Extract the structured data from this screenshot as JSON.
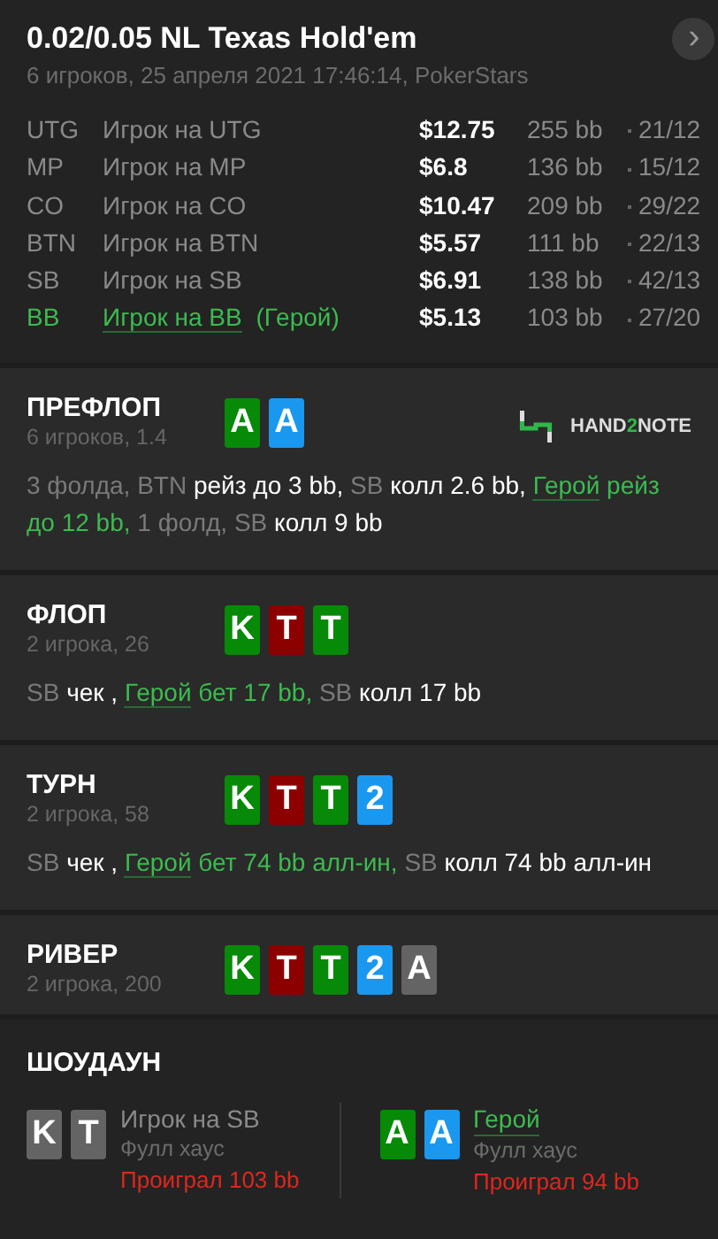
{
  "header": {
    "title": "0.02/0.05 NL Texas Hold'em",
    "subtitle": "6 игроков, 25 апреля 2021 17:46:14, PokerStars",
    "next_button": "›"
  },
  "players": [
    {
      "position": "UTG",
      "name": "Игрок на UTG",
      "hero": false,
      "stack": "$12.75",
      "bb": "255 bb",
      "stats": "21/12"
    },
    {
      "position": "MP",
      "name": "Игрок на MP",
      "hero": false,
      "stack": "$6.8",
      "bb": "136 bb",
      "stats": "15/12"
    },
    {
      "position": "CO",
      "name": "Игрок на CO",
      "hero": false,
      "stack": "$10.47",
      "bb": "209 bb",
      "stats": "29/22"
    },
    {
      "position": "BTN",
      "name": "Игрок на BTN",
      "hero": false,
      "stack": "$5.57",
      "bb": "111 bb",
      "stats": "22/13"
    },
    {
      "position": "SB",
      "name": "Игрок на SB",
      "hero": false,
      "stack": "$6.91",
      "bb": "138 bb",
      "stats": "42/13"
    },
    {
      "position": "BB",
      "name": "Игрок на BB",
      "hero": true,
      "hero_tag": "(Герой)",
      "stack": "$5.13",
      "bb": "103 bb",
      "stats": "27/20"
    }
  ],
  "streets": [
    {
      "name": "ПРЕФЛОП",
      "info": "6 игроков, 1.4",
      "logo": [
        "HAND",
        "2",
        "NOTE"
      ],
      "cards": [
        {
          "rank": "A",
          "color": "#078a07"
        },
        {
          "rank": "A",
          "color": "#1a98f0"
        }
      ],
      "actions": [
        {
          "kind": "player",
          "text": "3 фолда, BTN "
        },
        {
          "kind": "action",
          "text": "рейз до 3 bb, "
        },
        {
          "kind": "player",
          "text": "SB "
        },
        {
          "kind": "action",
          "text": "колл 2.6 bb, "
        },
        {
          "kind": "hero",
          "text": "Герой"
        },
        {
          "kind": "hero_action",
          "text": " рейз до 12 bb, "
        },
        {
          "kind": "player",
          "text": "1 фолд, SB "
        },
        {
          "kind": "action",
          "text": "колл 9 bb"
        }
      ]
    },
    {
      "name": "ФЛОП",
      "info": "2 игрока, 26",
      "cards": [
        {
          "rank": "K",
          "color": "#078a07"
        },
        {
          "rank": "T",
          "color": "#8c0000"
        },
        {
          "rank": "T",
          "color": "#078a07"
        }
      ],
      "actions": [
        {
          "kind": "player",
          "text": "SB "
        },
        {
          "kind": "action",
          "text": "чек , "
        },
        {
          "kind": "hero",
          "text": "Герой"
        },
        {
          "kind": "hero_action",
          "text": " бет 17 bb, "
        },
        {
          "kind": "player",
          "text": "SB "
        },
        {
          "kind": "action",
          "text": "колл 17 bb"
        }
      ]
    },
    {
      "name": "ТУРН",
      "info": "2 игрока, 58",
      "cards": [
        {
          "rank": "K",
          "color": "#078a07"
        },
        {
          "rank": "T",
          "color": "#8c0000"
        },
        {
          "rank": "T",
          "color": "#078a07"
        },
        {
          "rank": "2",
          "color": "#1a98f0"
        }
      ],
      "actions": [
        {
          "kind": "player",
          "text": "SB "
        },
        {
          "kind": "action",
          "text": "чек , "
        },
        {
          "kind": "hero",
          "text": "Герой"
        },
        {
          "kind": "hero_action",
          "text": " бет 74 bb алл-ин, "
        },
        {
          "kind": "player",
          "text": "SB "
        },
        {
          "kind": "action",
          "text": "колл 74 bb алл-ин"
        }
      ]
    },
    {
      "name": "РИВЕР",
      "info": "2 игрока, 200",
      "cards": [
        {
          "rank": "K",
          "color": "#078a07"
        },
        {
          "rank": "T",
          "color": "#8c0000"
        },
        {
          "rank": "T",
          "color": "#078a07"
        },
        {
          "rank": "2",
          "color": "#1a98f0"
        },
        {
          "rank": "A",
          "color": "#646464"
        }
      ]
    }
  ],
  "showdown": {
    "title": "ШОУДАУН",
    "players": [
      {
        "name": "Игрок на SB",
        "hero": false,
        "hand": "Фулл хаус",
        "result": "Проиграл 103 bb",
        "cards": [
          {
            "rank": "K",
            "color": "#646464"
          },
          {
            "rank": "T",
            "color": "#646464"
          }
        ]
      },
      {
        "name": "Герой",
        "hero": true,
        "hand": "Фулл хаус",
        "result": "Проиграл 94 bb",
        "cards": [
          {
            "rank": "A",
            "color": "#078a07"
          },
          {
            "rank": "A",
            "color": "#1a98f0"
          }
        ]
      }
    ]
  }
}
